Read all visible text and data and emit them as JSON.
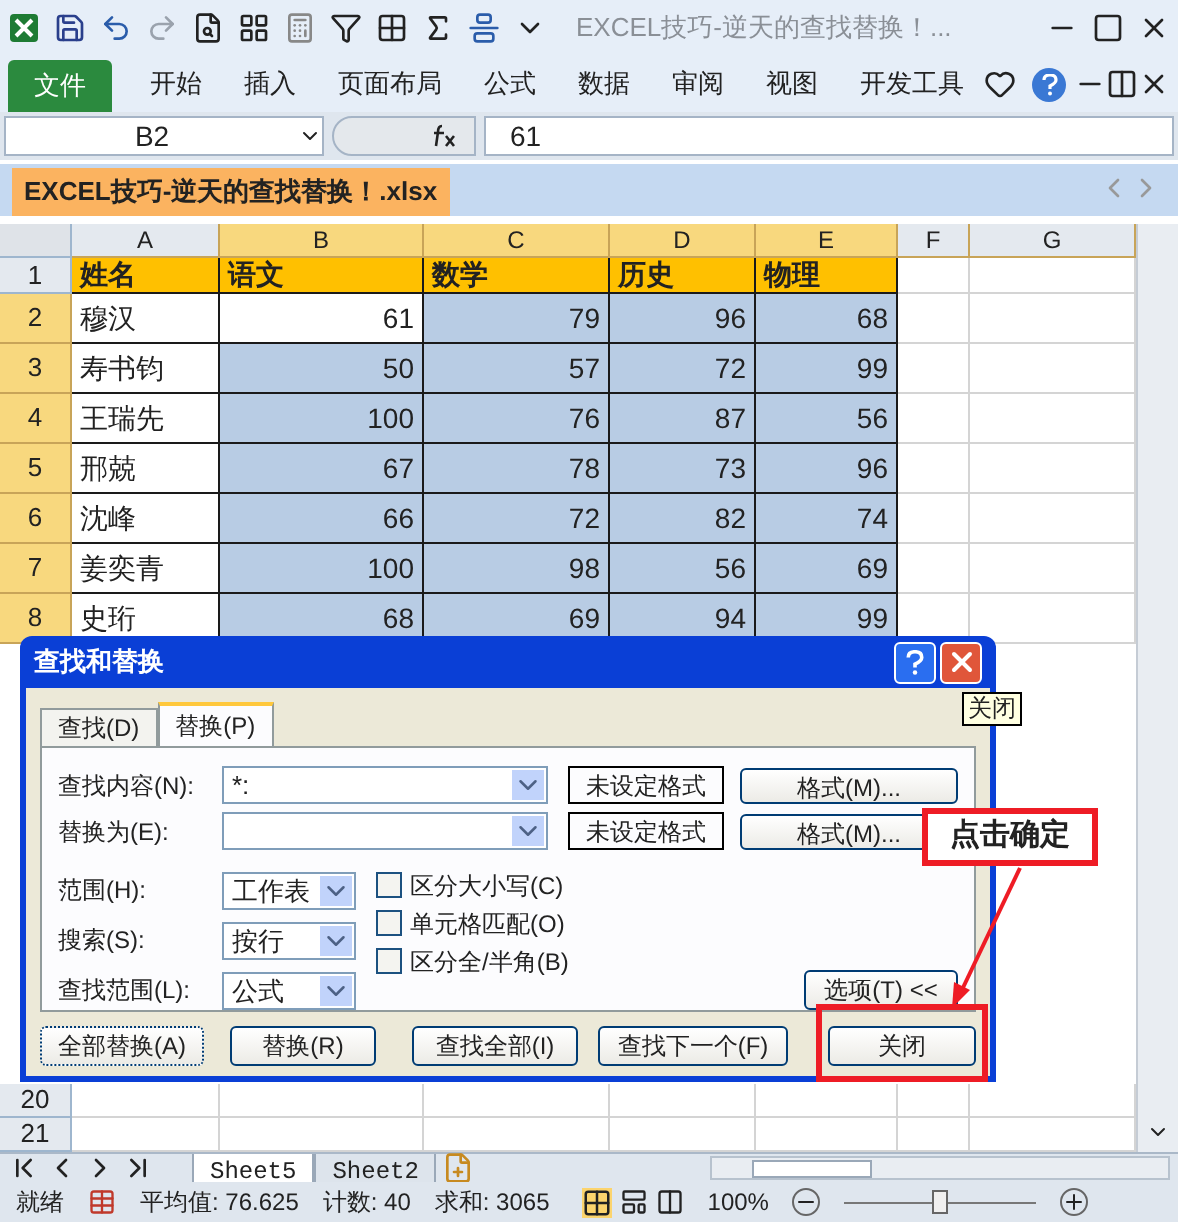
{
  "title_bar": {
    "title": "EXCEL技巧-逆天的查找替换！..."
  },
  "ribbon": {
    "file_tab": "文件",
    "tabs": [
      {
        "label": "开始",
        "selected": false
      },
      {
        "label": "插入",
        "selected": false
      },
      {
        "label": "页面布局",
        "selected": false
      },
      {
        "label": "公式",
        "selected": false
      },
      {
        "label": "数据",
        "selected": false
      },
      {
        "label": "审阅",
        "selected": false
      },
      {
        "label": "视图",
        "selected": false
      },
      {
        "label": "开发工具",
        "selected": false
      }
    ]
  },
  "formula_bar": {
    "name_box": "B2",
    "value": "61"
  },
  "workbook_tab": {
    "title": "EXCEL技巧-逆天的查找替换！.xlsx"
  },
  "grid": {
    "columns": [
      {
        "label": "A",
        "selected": false
      },
      {
        "label": "B",
        "selected": true
      },
      {
        "label": "C",
        "selected": true
      },
      {
        "label": "D",
        "selected": true
      },
      {
        "label": "E",
        "selected": true
      },
      {
        "label": "F",
        "selected": false
      },
      {
        "label": "G",
        "selected": false
      }
    ],
    "rows": [
      {
        "number": "1",
        "selected": false,
        "kind": "header",
        "cells": [
          {
            "text": "姓名"
          },
          {
            "text": "语文"
          },
          {
            "text": "数学"
          },
          {
            "text": "历史"
          },
          {
            "text": "物理"
          }
        ]
      },
      {
        "number": "2",
        "selected": true,
        "kind": "data",
        "cells": [
          {
            "text": "穆汉",
            "selected": false
          },
          {
            "text": "61",
            "selected": false
          },
          {
            "text": "79",
            "selected": true
          },
          {
            "text": "96",
            "selected": true
          },
          {
            "text": "68",
            "selected": true
          }
        ]
      },
      {
        "number": "3",
        "selected": true,
        "kind": "data",
        "cells": [
          {
            "text": "寿书钧",
            "selected": false
          },
          {
            "text": "50",
            "selected": true
          },
          {
            "text": "57",
            "selected": true
          },
          {
            "text": "72",
            "selected": true
          },
          {
            "text": "99",
            "selected": true
          }
        ]
      },
      {
        "number": "4",
        "selected": true,
        "kind": "data",
        "cells": [
          {
            "text": "王瑞先",
            "selected": false
          },
          {
            "text": "100",
            "selected": true
          },
          {
            "text": "76",
            "selected": true
          },
          {
            "text": "87",
            "selected": true
          },
          {
            "text": "56",
            "selected": true
          }
        ]
      },
      {
        "number": "5",
        "selected": true,
        "kind": "data",
        "cells": [
          {
            "text": "邢兢",
            "selected": false
          },
          {
            "text": "67",
            "selected": true
          },
          {
            "text": "78",
            "selected": true
          },
          {
            "text": "73",
            "selected": true
          },
          {
            "text": "96",
            "selected": true
          }
        ]
      },
      {
        "number": "6",
        "selected": true,
        "kind": "data",
        "cells": [
          {
            "text": "沈峰",
            "selected": false
          },
          {
            "text": "66",
            "selected": true
          },
          {
            "text": "72",
            "selected": true
          },
          {
            "text": "82",
            "selected": true
          },
          {
            "text": "74",
            "selected": true
          }
        ]
      },
      {
        "number": "7",
        "selected": true,
        "kind": "data",
        "cells": [
          {
            "text": "姜奕青",
            "selected": false
          },
          {
            "text": "100",
            "selected": true
          },
          {
            "text": "98",
            "selected": true
          },
          {
            "text": "56",
            "selected": true
          },
          {
            "text": "69",
            "selected": true
          }
        ]
      },
      {
        "number": "8",
        "selected": true,
        "kind": "data",
        "cells": [
          {
            "text": "史珩",
            "selected": false
          },
          {
            "text": "68",
            "selected": true
          },
          {
            "text": "69",
            "selected": true
          },
          {
            "text": "94",
            "selected": true
          },
          {
            "text": "99",
            "selected": true
          }
        ]
      }
    ],
    "bottom_rows": [
      {
        "number": "20",
        "selected": false
      },
      {
        "number": "21",
        "selected": false
      }
    ]
  },
  "dialog": {
    "title": "查找和替换",
    "tooltip": "关闭",
    "tabs": [
      {
        "label": "查找(D)",
        "selected": false
      },
      {
        "label": "替换(P)",
        "selected": true
      }
    ],
    "find": {
      "label": "查找内容(N):",
      "value": "*:",
      "format_status": "未设定格式",
      "format_button": "格式(M)..."
    },
    "replace": {
      "label": "替换为(E):",
      "format_status": "未设定格式",
      "format_button": "格式(M)..."
    },
    "options": [
      {
        "label": "范围(H):",
        "value": "工作表"
      },
      {
        "label": "搜索(S):",
        "value": "按行"
      },
      {
        "label": "查找范围(L):",
        "value": "公式"
      }
    ],
    "checkboxes": [
      {
        "label": "区分大小写(C)",
        "checked": false
      },
      {
        "label": "单元格匹配(O)",
        "checked": false
      },
      {
        "label": "区分全/半角(B)",
        "checked": false
      }
    ],
    "options_button": "选项(T) <<",
    "buttons": [
      "全部替换(A)",
      "替换(R)",
      "查找全部(I)",
      "查找下一个(F)",
      "关闭"
    ]
  },
  "callout": {
    "text": "点击确定"
  },
  "sheet_tabs": [
    {
      "label": "Sheet5",
      "selected": true
    },
    {
      "label": "Sheet2",
      "selected": false
    }
  ],
  "status_bar": {
    "ready": "就绪",
    "average": "平均值: 76.625",
    "count": "计数: 40",
    "sum": "求和: 3065",
    "zoom": "100%",
    "zoom_level": {
      "level": 0.5
    }
  }
}
